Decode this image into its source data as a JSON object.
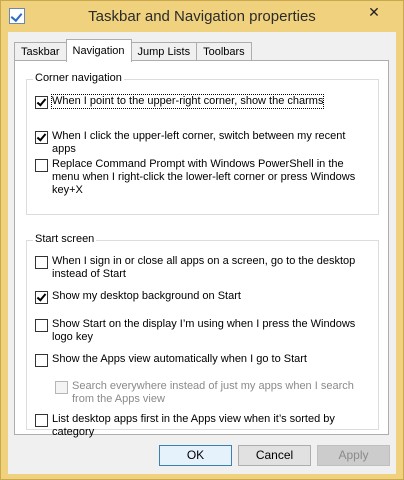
{
  "window": {
    "title": "Taskbar and Navigation properties",
    "close_glyph": "✕"
  },
  "tabs": [
    {
      "label": "Taskbar",
      "active": false
    },
    {
      "label": "Navigation",
      "active": true
    },
    {
      "label": "Jump Lists",
      "active": false
    },
    {
      "label": "Toolbars",
      "active": false
    }
  ],
  "corner_navigation": {
    "title": "Corner navigation",
    "options": [
      {
        "label": "When I point to the upper-right corner, show the charms",
        "checked": true,
        "disabled": false
      },
      {
        "label": "When I click the upper-left corner, switch between my recent apps",
        "checked": true,
        "disabled": false
      },
      {
        "label": "Replace Command Prompt with Windows PowerShell in the menu when I right-click the lower-left corner or press Windows key+X",
        "checked": false,
        "disabled": false
      }
    ]
  },
  "start_screen": {
    "title": "Start screen",
    "options": [
      {
        "label": "When I sign in or close all apps on a screen, go to the desktop instead of Start",
        "checked": false,
        "disabled": false
      },
      {
        "label": "Show my desktop background on Start",
        "checked": true,
        "disabled": false
      },
      {
        "label": "Show Start on the display I’m using when I press the Windows logo key",
        "checked": false,
        "disabled": false
      },
      {
        "label": "Show the Apps view automatically when I go to Start",
        "checked": false,
        "disabled": false
      },
      {
        "label": "Search everywhere instead of just my apps when I search from the Apps view",
        "checked": false,
        "disabled": true
      },
      {
        "label": "List desktop apps first in the Apps view when it’s sorted by category",
        "checked": false,
        "disabled": false
      }
    ]
  },
  "buttons": {
    "ok": "OK",
    "cancel": "Cancel",
    "apply": "Apply"
  },
  "colors": {
    "title_bar": "#f0d27e",
    "dialog_bg": "#f0f0f0",
    "default_button_border": "#3c7fb1"
  }
}
